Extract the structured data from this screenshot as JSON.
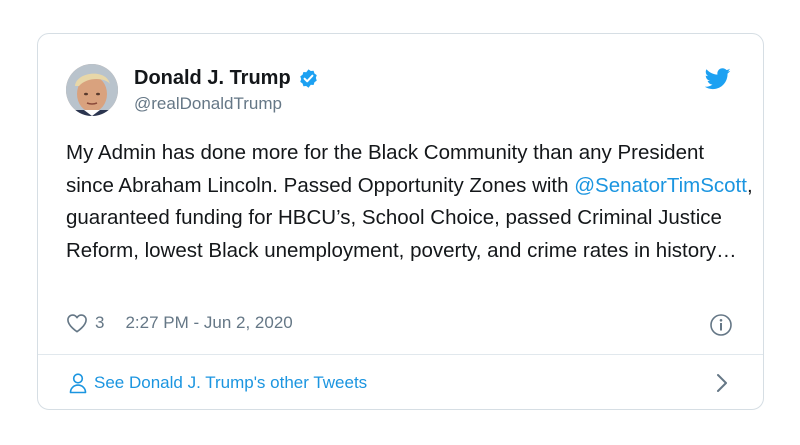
{
  "tweet": {
    "display_name": "Donald J. Trump",
    "handle": "@realDonaldTrump",
    "text_part1": "My Admin has done more for the Black Community than any President since Abraham Lincoln. Passed Opportunity Zones with ",
    "mention": "@SenatorTimScott",
    "text_part2": ", guaranteed funding for HBCU’s, School Choice, passed Criminal Justice Reform, lowest Black unemployment, poverty, and crime rates in history…",
    "like_count": "3",
    "timestamp": "2:27 PM - Jun 2, 2020",
    "footer_label": "See Donald J. Trump's other Tweets"
  },
  "colors": {
    "link": "#1b95e0",
    "text": "#14171a",
    "muted": "#657786",
    "border": "#d6dee4"
  },
  "icons": [
    "avatar",
    "verified-badge-icon",
    "twitter-bird-icon",
    "heart-icon",
    "info-icon",
    "person-icon",
    "chevron-right-icon"
  ]
}
